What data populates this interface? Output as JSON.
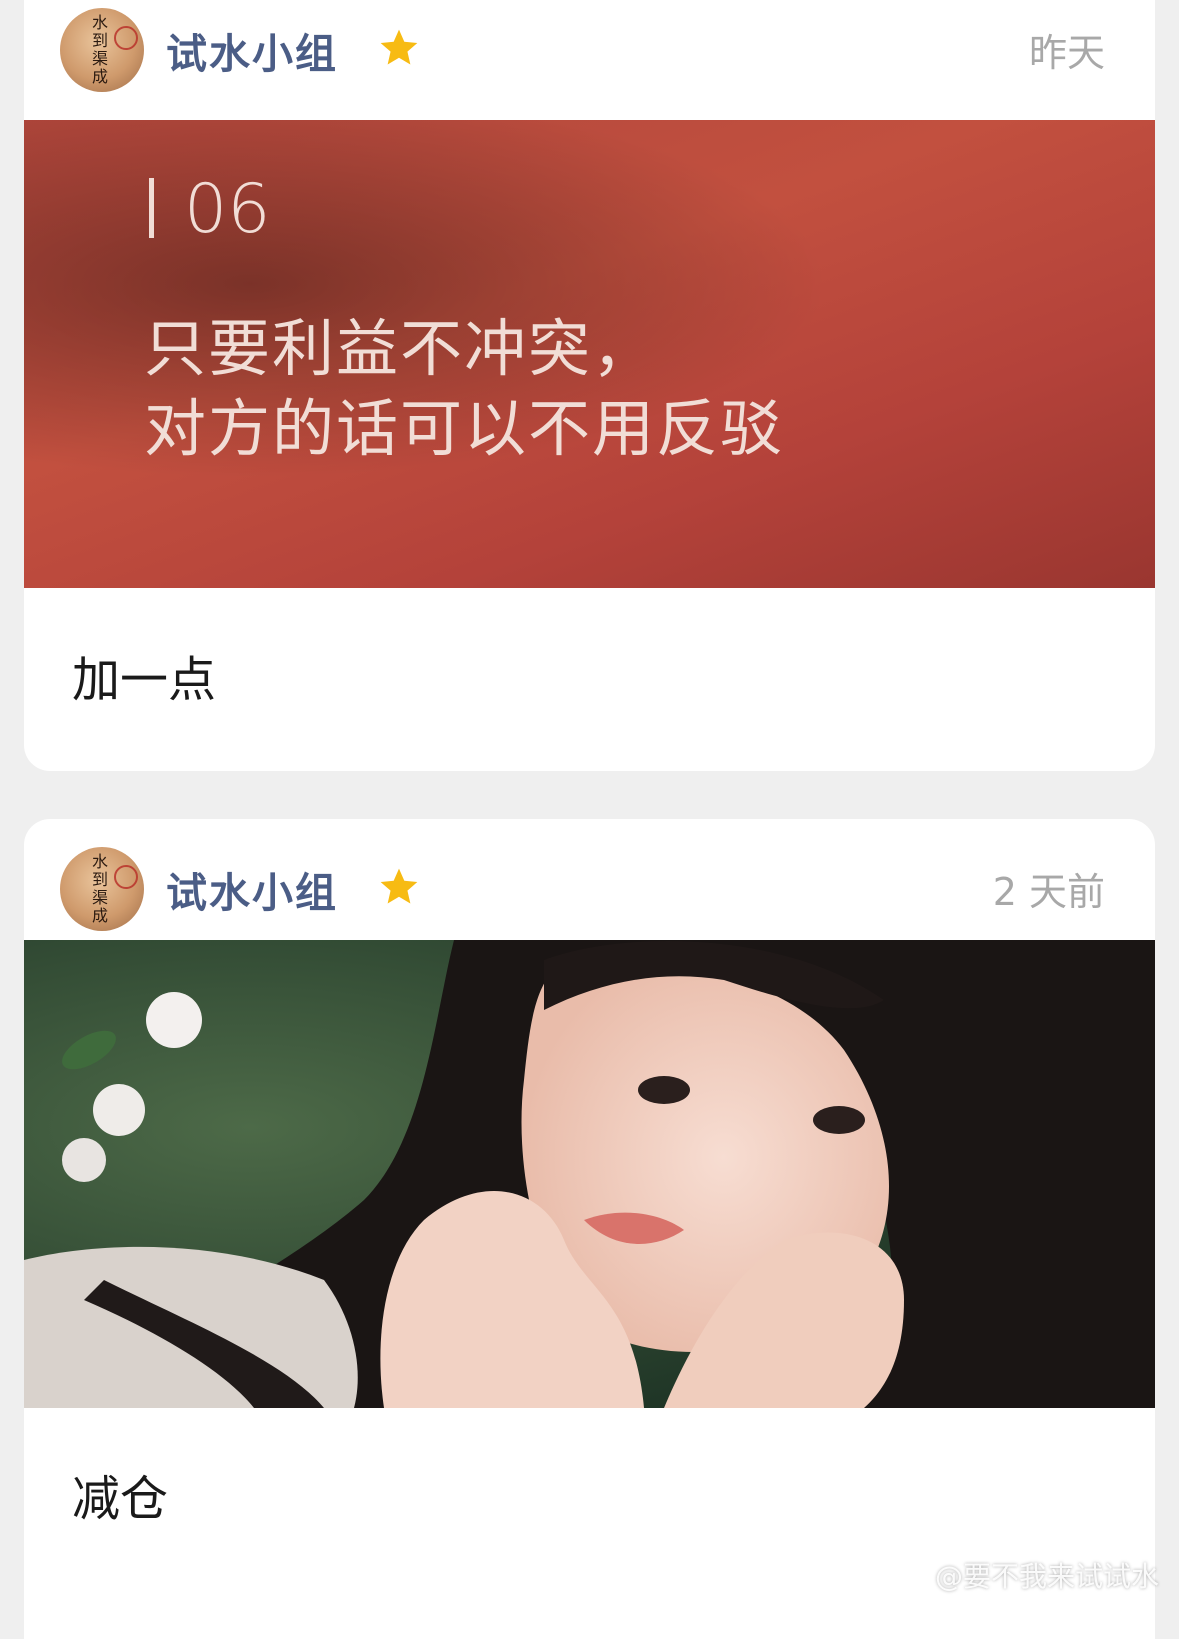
{
  "posts": [
    {
      "author": "试水小组",
      "avatar_seal_text": "水到渠成",
      "time": "昨天",
      "image": {
        "number": "06",
        "line1": "只要利益不冲突，",
        "line2": "对方的话可以不用反驳"
      },
      "caption": "加一点"
    },
    {
      "author": "试水小组",
      "avatar_seal_text": "水到渠成",
      "time": "2 天前",
      "caption": "减仓"
    }
  ],
  "watermark": "@要不我来试试水",
  "colors": {
    "author": "#4b5d86",
    "star": "#f7bb13",
    "time": "#a8a8a8"
  }
}
